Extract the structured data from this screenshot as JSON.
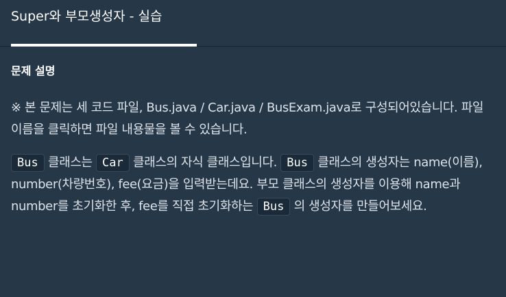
{
  "header": {
    "tab_title": "Super와 부모생성자 - 실습"
  },
  "problem": {
    "section_title": "문제 설명",
    "para1": "※ 본 문제는 세 코드 파일, Bus.java / Car.java / BusExam.java로 구성되어있습니다. 파일 이름을 클릭하면 파일 내용물을 볼 수 있습니다.",
    "para2": {
      "code_bus_1": "Bus",
      "text_1": " 클래스는 ",
      "code_car": "Car",
      "text_2": " 클래스의 자식 클래스입니다. ",
      "code_bus_2": "Bus",
      "text_3": " 클래스의 생성자는 name(이름), number(차량번호), fee(요금)을 입력받는데요. 부모 클래스의 생성자를 이용해 name과 number를 초기화한 후, fee를 직접 초기화하는 ",
      "code_bus_3": "Bus",
      "text_4": " 의 생성자를 만들어보세요."
    }
  }
}
